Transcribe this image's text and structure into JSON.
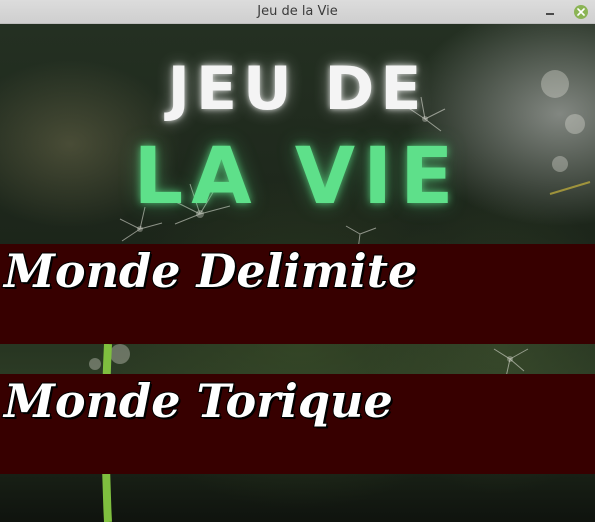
{
  "window": {
    "title": "Jeu de la Vie",
    "close_color": "#8bb455"
  },
  "header": {
    "line1": "JEU DE",
    "line2": "LA VIE",
    "line1_color": "#f4f4f4",
    "line2_color": "#5ee08a"
  },
  "menu": {
    "bounded_label": "Monde Delimite",
    "toric_label": "Monde Torique",
    "button_color": "#370000"
  }
}
